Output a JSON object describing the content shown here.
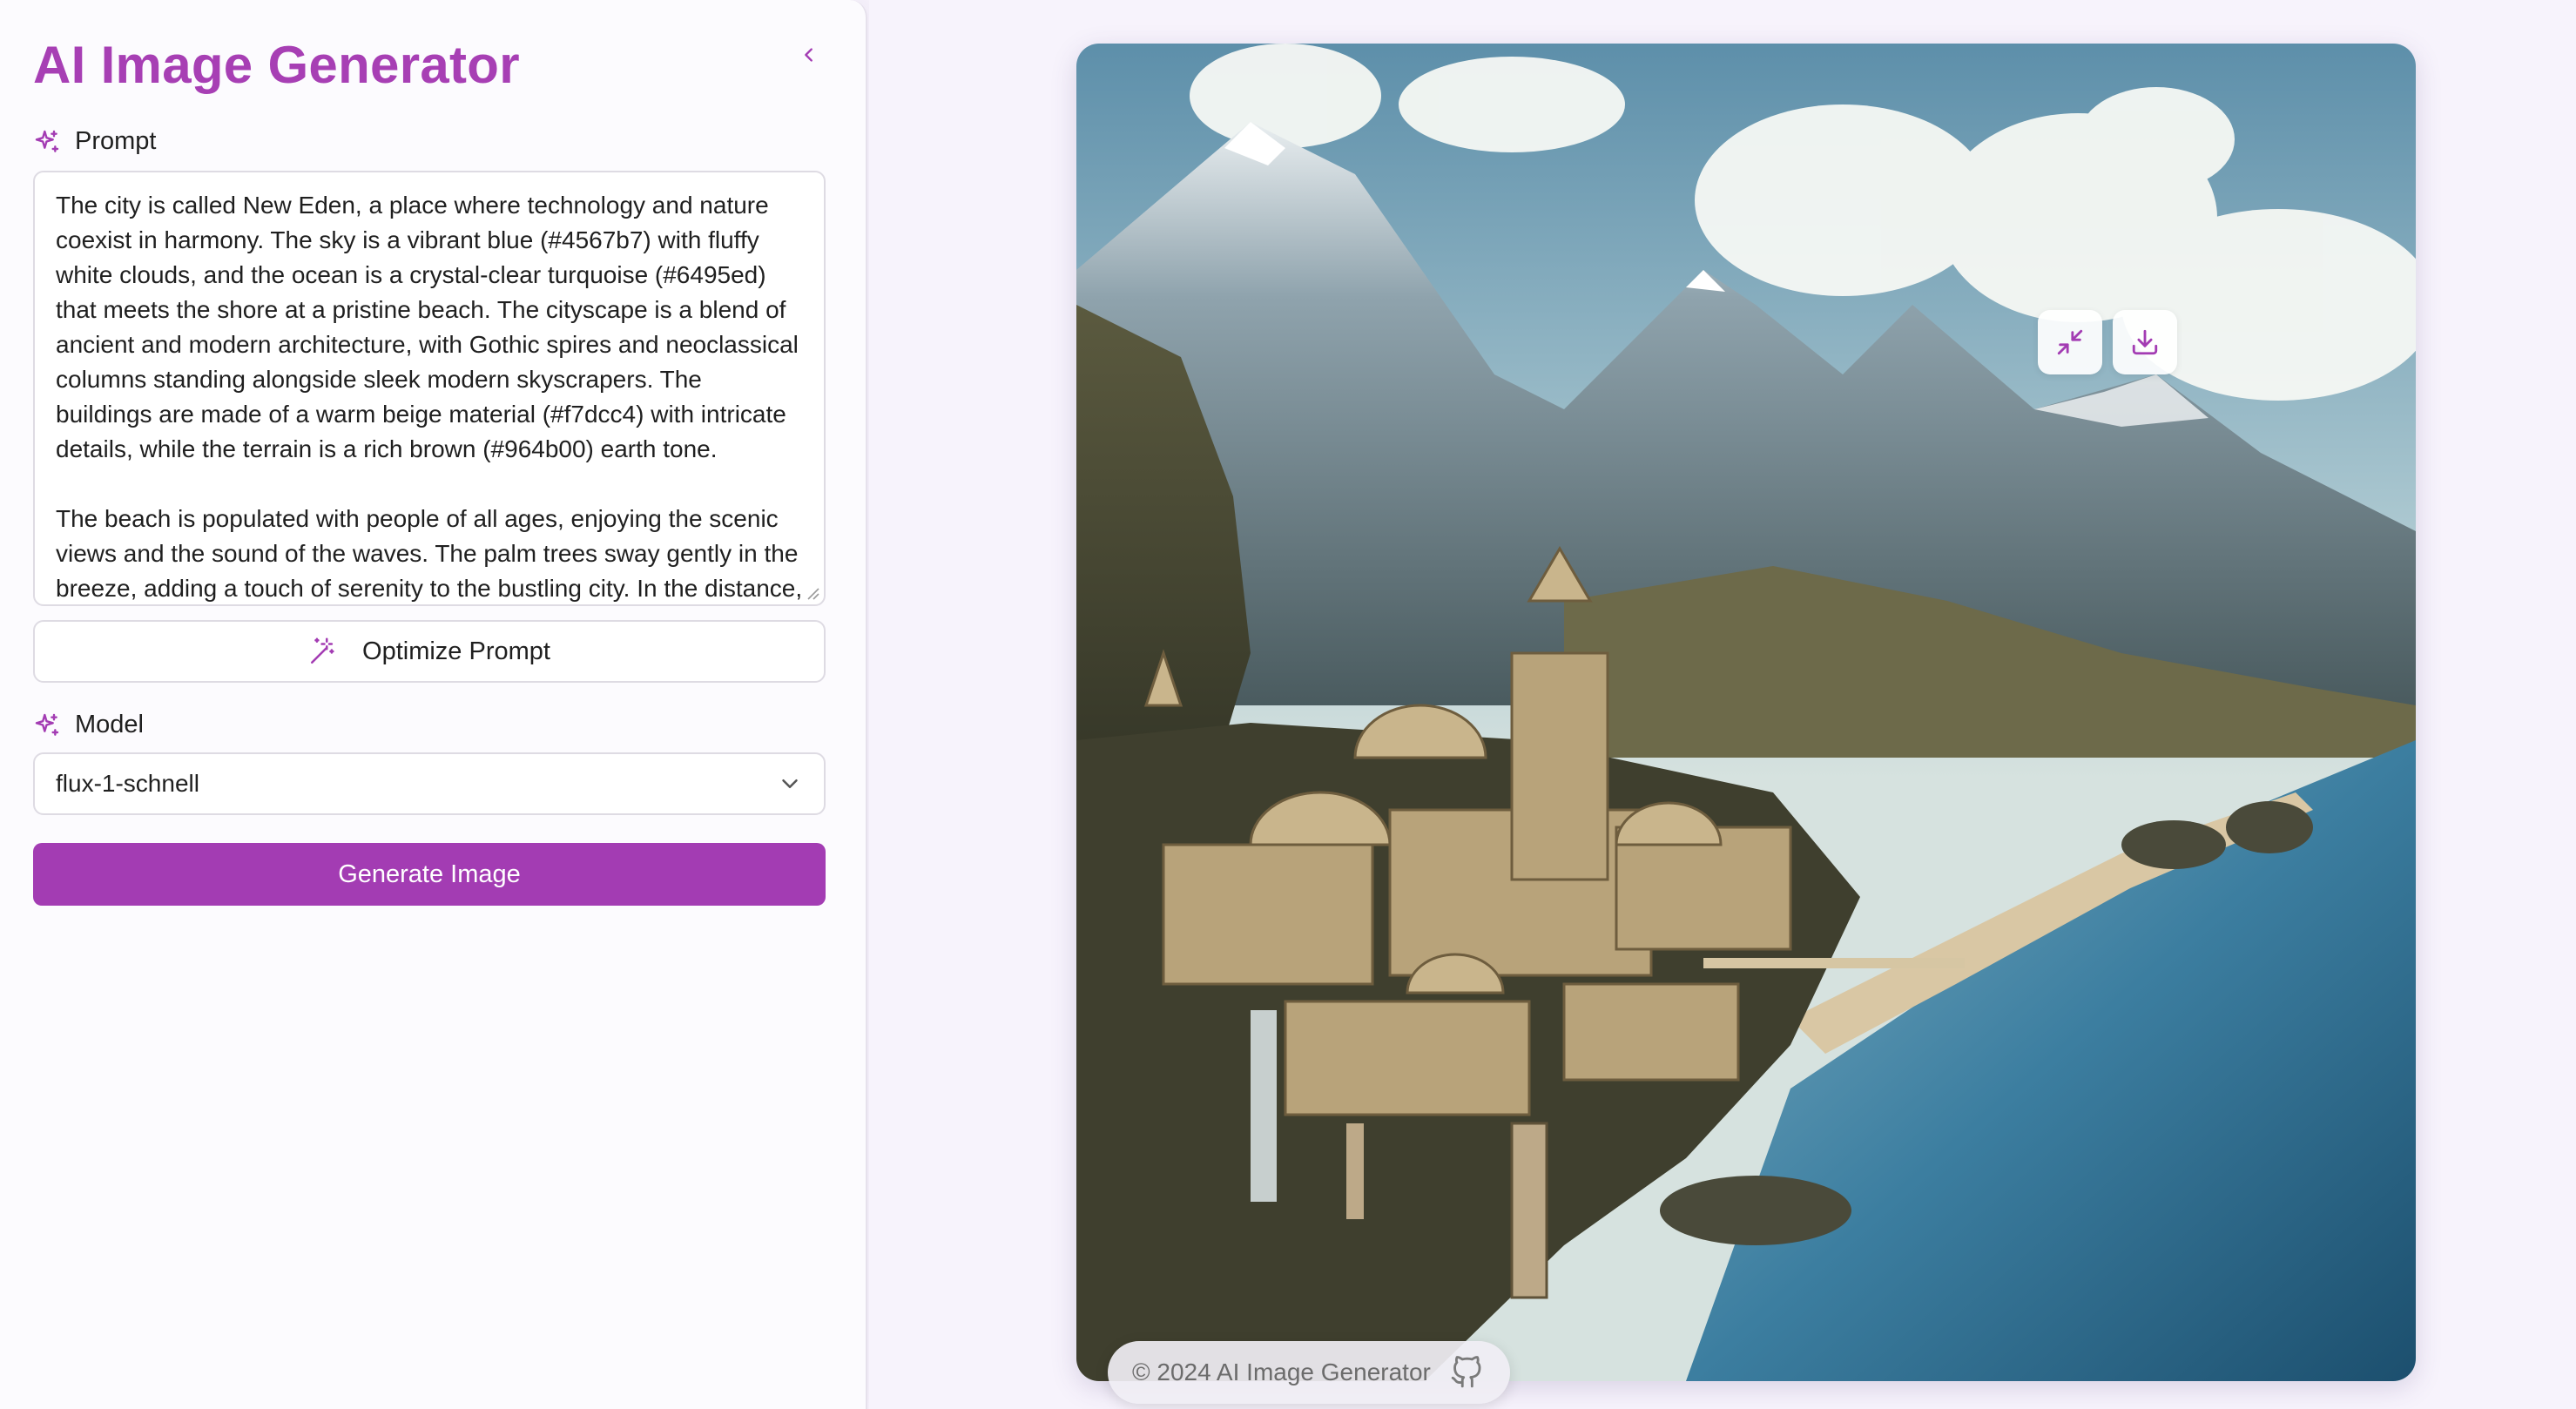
{
  "app": {
    "title": "AI Image Generator",
    "accent_color": "#a33cb3"
  },
  "sidebar": {
    "collapse_icon": "chevron-left-icon",
    "prompt": {
      "label": "Prompt",
      "icon": "sparkles-icon",
      "value": "The city is called New Eden, a place where technology and nature coexist in harmony. The sky is a vibrant blue (#4567b7) with fluffy white clouds, and the ocean is a crystal-clear turquoise (#6495ed) that meets the shore at a pristine beach. The cityscape is a blend of ancient and modern architecture, with Gothic spires and neoclassical columns standing alongside sleek modern skyscrapers. The buildings are made of a warm beige material (#f7dcc4) with intricate details, while the terrain is a rich brown (#964b00) earth tone.\n\nThe beach is populated with people of all ages, enjoying the scenic views and the sound of the waves. The palm trees sway gently in the breeze, adding a touch of serenity to the bustling city. In the distance,"
    },
    "optimize_button": {
      "label": "Optimize Prompt",
      "icon": "magic-wand-icon"
    },
    "model": {
      "label": "Model",
      "icon": "sparkles-icon",
      "selected": "flux-1-schnell",
      "dropdown_icon": "chevron-down-icon"
    },
    "generate_button": {
      "label": "Generate Image"
    }
  },
  "main": {
    "image": {
      "description_icon": "generated-image",
      "actions": [
        {
          "name": "minimize",
          "icon": "minimize-icon"
        },
        {
          "name": "download",
          "icon": "download-icon"
        }
      ]
    },
    "footer": {
      "text": "© 2024 AI Image Generator",
      "icon": "github-icon"
    }
  }
}
